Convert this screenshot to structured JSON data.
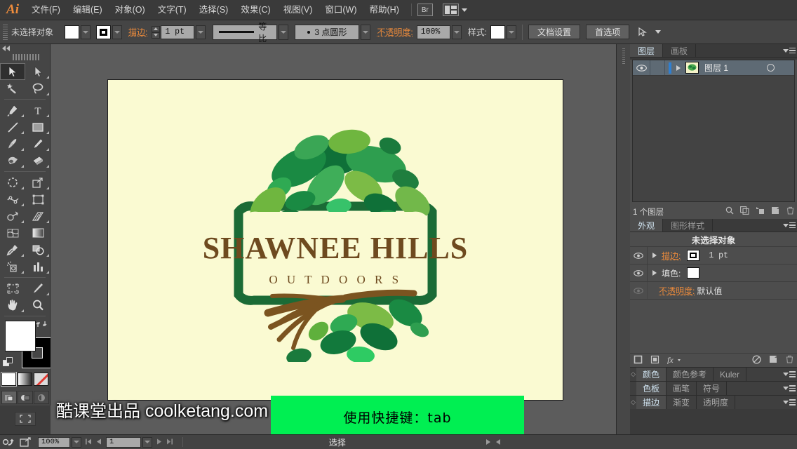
{
  "app": {
    "name": "Ai",
    "menus": [
      {
        "label": "文件(F)"
      },
      {
        "label": "编辑(E)"
      },
      {
        "label": "对象(O)"
      },
      {
        "label": "文字(T)"
      },
      {
        "label": "选择(S)"
      },
      {
        "label": "效果(C)"
      },
      {
        "label": "视图(V)"
      },
      {
        "label": "窗口(W)"
      },
      {
        "label": "帮助(H)"
      }
    ],
    "bridge_button": "Br"
  },
  "control_bar": {
    "selection_status": "未选择对象",
    "stroke_label": "描边:",
    "stroke_weight": "1 pt",
    "width_profile": "等比",
    "brush_definition": "3 点圆形",
    "opacity_label": "不透明度:",
    "opacity_value": "100%",
    "style_label": "样式:",
    "document_setup": "文档设置",
    "preferences": "首选项"
  },
  "toolbox": {
    "tools": [
      {
        "name": "selection-tool",
        "active": true
      },
      {
        "name": "direct-selection-tool",
        "active": false
      },
      {
        "name": "magic-wand-tool",
        "active": false
      },
      {
        "name": "lasso-tool",
        "active": false
      },
      {
        "name": "pen-tool",
        "active": false
      },
      {
        "name": "type-tool",
        "active": false
      },
      {
        "name": "line-segment-tool",
        "active": false
      },
      {
        "name": "rectangle-tool",
        "active": false
      },
      {
        "name": "paintbrush-tool",
        "active": false
      },
      {
        "name": "pencil-tool",
        "active": false
      },
      {
        "name": "blob-brush-tool",
        "active": false
      },
      {
        "name": "eraser-tool",
        "active": false
      },
      {
        "name": "rotate-tool",
        "active": false
      },
      {
        "name": "scale-tool",
        "active": false
      },
      {
        "name": "width-tool",
        "active": false
      },
      {
        "name": "free-transform-tool",
        "active": false
      },
      {
        "name": "shape-builder-tool",
        "active": false
      },
      {
        "name": "perspective-grid-tool",
        "active": false
      },
      {
        "name": "mesh-tool",
        "active": false
      },
      {
        "name": "gradient-tool",
        "active": false
      },
      {
        "name": "eyedropper-tool",
        "active": false
      },
      {
        "name": "blend-tool",
        "active": false
      },
      {
        "name": "symbol-sprayer-tool",
        "active": false
      },
      {
        "name": "column-graph-tool",
        "active": false
      },
      {
        "name": "artboard-tool",
        "active": false
      },
      {
        "name": "slice-tool",
        "active": false
      },
      {
        "name": "hand-tool",
        "active": false
      },
      {
        "name": "zoom-tool",
        "active": false
      }
    ],
    "fill_color": "#ffffff",
    "stroke_color": "#000000"
  },
  "canvas": {
    "artboard_color": "#fafad2",
    "background_color": "#5c5c5c",
    "callout": {
      "text": "使用快捷键：tab",
      "background": "#00ef52"
    },
    "logo": {
      "title": "SHAWNEE HILLS",
      "subtitle": "O U T D O O R S",
      "text_color": "#6e4a1f",
      "leaf_dark": "#0f7038",
      "leaf_mid": "#35a14a",
      "leaf_light": "#76b943",
      "trunk_color": "#7b5420",
      "frame_color": "#1b6b36"
    }
  },
  "watermark": {
    "cn": "酷课堂出品",
    "domain": "coolketang.com"
  },
  "layers_panel": {
    "tabs": [
      {
        "label": "图层",
        "active": true
      },
      {
        "label": "画板",
        "active": false
      }
    ],
    "rows": [
      {
        "name": "图层 1"
      }
    ],
    "footer_count": "1 个图层"
  },
  "appearance_panel": {
    "tabs": [
      {
        "label": "外观",
        "active": true
      },
      {
        "label": "图形样式",
        "active": false
      }
    ],
    "header": "未选择对象",
    "rows": [
      {
        "label": "描边:",
        "value": "1 pt",
        "orange": true
      },
      {
        "label": "填色:",
        "value": "",
        "orange": false
      },
      {
        "label": "不透明度:",
        "value": "默认值",
        "orange": true
      }
    ]
  },
  "collapsed_panels": [
    {
      "tabs": [
        {
          "label": "颜色",
          "active": true
        },
        {
          "label": "颜色参考",
          "active": false
        },
        {
          "label": "Kuler",
          "active": false
        }
      ],
      "grip": true
    },
    {
      "tabs": [
        {
          "label": "色板",
          "active": true
        },
        {
          "label": "画笔",
          "active": false
        },
        {
          "label": "符号",
          "active": false
        }
      ],
      "grip": false
    },
    {
      "tabs": [
        {
          "label": "描边",
          "active": true
        },
        {
          "label": "渐变",
          "active": false
        },
        {
          "label": "透明度",
          "active": false
        }
      ],
      "grip": true
    }
  ],
  "status_bar": {
    "zoom": "100%",
    "page": "1",
    "status_text": "选择"
  }
}
